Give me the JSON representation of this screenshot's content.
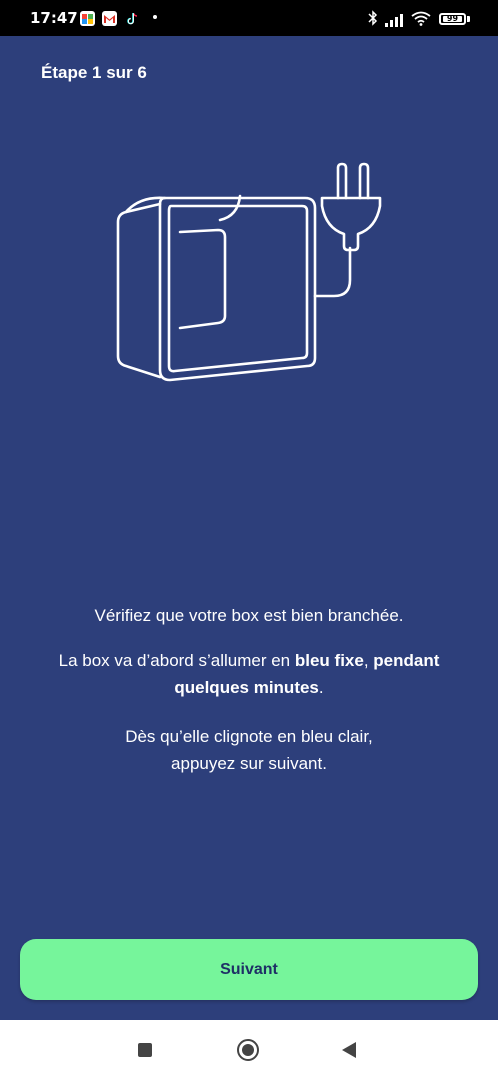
{
  "status_bar": {
    "time": "17:47",
    "battery_level": "99",
    "battery_fraction": 0.99,
    "icons": [
      "app-notification-icon",
      "gmail-icon",
      "tiktok-icon",
      "bluetooth-icon",
      "signal-icon",
      "wifi-icon",
      "battery-icon"
    ]
  },
  "onboarding": {
    "step_label": "Étape 1 sur 6",
    "illustration": "router-box-with-power-plug-icon",
    "instruction_1": "Vérifiez que votre box est bien branchée.",
    "instruction_2_pre": "La box va d’abord s’allumer en ",
    "instruction_2_bold_a": "bleu fixe",
    "instruction_2_sep": ", ",
    "instruction_2_bold_b": "pendant quelques minutes",
    "instruction_2_post": ".",
    "instruction_3_line1": "Dès qu’elle clignote en bleu clair,",
    "instruction_3_line2": "appuyez sur suivant.",
    "next_button_label": "Suivant"
  },
  "colors": {
    "background": "#2d3f7b",
    "button": "#76f59b",
    "button_text": "#1e3066"
  },
  "nav_bar": {
    "icons": [
      "recent-apps-icon",
      "home-icon",
      "back-icon"
    ]
  }
}
